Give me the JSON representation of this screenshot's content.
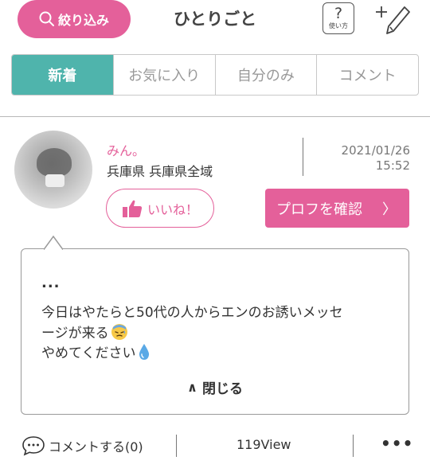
{
  "header": {
    "filter_label": "絞り込み",
    "title": "ひとりごと",
    "help_symbol": "?",
    "help_label": "使い方",
    "compose_icon": "plus-pencil-icon"
  },
  "tabs": [
    {
      "label": "新着",
      "active": true
    },
    {
      "label": "お気に入り",
      "active": false
    },
    {
      "label": "自分のみ",
      "active": false
    },
    {
      "label": "コメント",
      "active": false
    }
  ],
  "post": {
    "username": "みん。",
    "location": "兵庫県 兵庫県全域",
    "date": "2021/01/26",
    "time": "15:52",
    "like_label": "いいね！",
    "profile_label": "プロフを確認",
    "profile_chevron": "〉",
    "body_ellipsis": "...",
    "body_line1": "今日はやたらと50代の人からエンのお誘いメッセ",
    "body_line2": "ージが来る",
    "body_line3": "やめてください",
    "close_label": "閉じる",
    "close_chevron": "∧",
    "comment_label": "コメントする(0)",
    "views": "119View",
    "more_label": "•••"
  },
  "colors": {
    "accent_pink": "#e4609a",
    "active_tab_teal": "#4fb4ac"
  }
}
